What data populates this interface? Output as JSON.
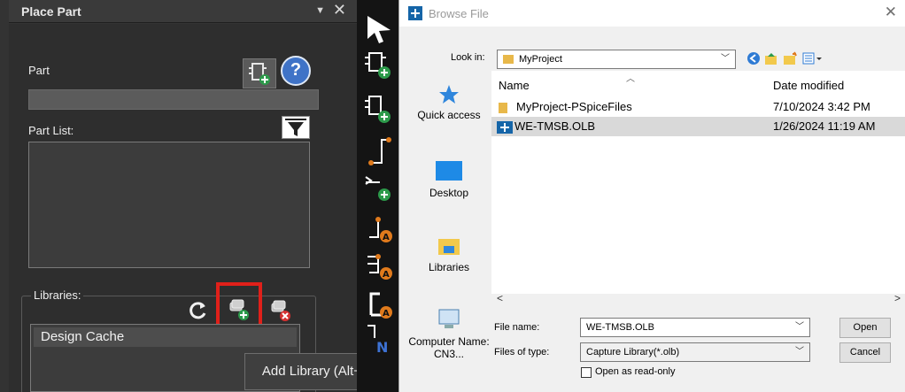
{
  "place_part": {
    "title": "Place Part",
    "part_label": "Part",
    "part_value": "",
    "part_list_label": "Part List:",
    "libraries_label": "Libraries:",
    "libraries": [
      "Design Cache"
    ],
    "tooltip": "Add Library (Alt+A)",
    "icons": [
      "add-part-icon",
      "help-icon",
      "filter-icon",
      "refresh-icon",
      "add-library-icon",
      "remove-library-icon"
    ],
    "highlight_color": "#e0201a"
  },
  "toolbar": {
    "icons": [
      "select-pointer-icon",
      "place-part-icon",
      "place-part-plus-icon",
      "place-wire-icon",
      "place-bus-icon",
      "place-net-alias-icon",
      "place-power-icon",
      "place-ground-icon",
      "place-no-connect-icon"
    ]
  },
  "dialog": {
    "title": "Browse File",
    "look_in_label": "Look in:",
    "look_in_value": "MyProject",
    "columns": {
      "name": "Name",
      "date": "Date modified"
    },
    "files": [
      {
        "name": "MyProject-PSpiceFiles",
        "date": "7/10/2024 3:42 PM",
        "type": "folder",
        "selected": false
      },
      {
        "name": "WE-TMSB.OLB",
        "date": "1/26/2024 11:19 AM",
        "type": "olb",
        "selected": true
      }
    ],
    "places": [
      "Quick access",
      "Desktop",
      "Libraries",
      "Computer Name: CN3..."
    ],
    "file_name_label": "File name:",
    "file_name_value": "WE-TMSB.OLB",
    "files_of_type_label": "Files of type:",
    "files_of_type_value": "Capture Library(*.olb)",
    "read_only_label": "Open as read-only",
    "open_label": "Open",
    "cancel_label": "Cancel"
  }
}
